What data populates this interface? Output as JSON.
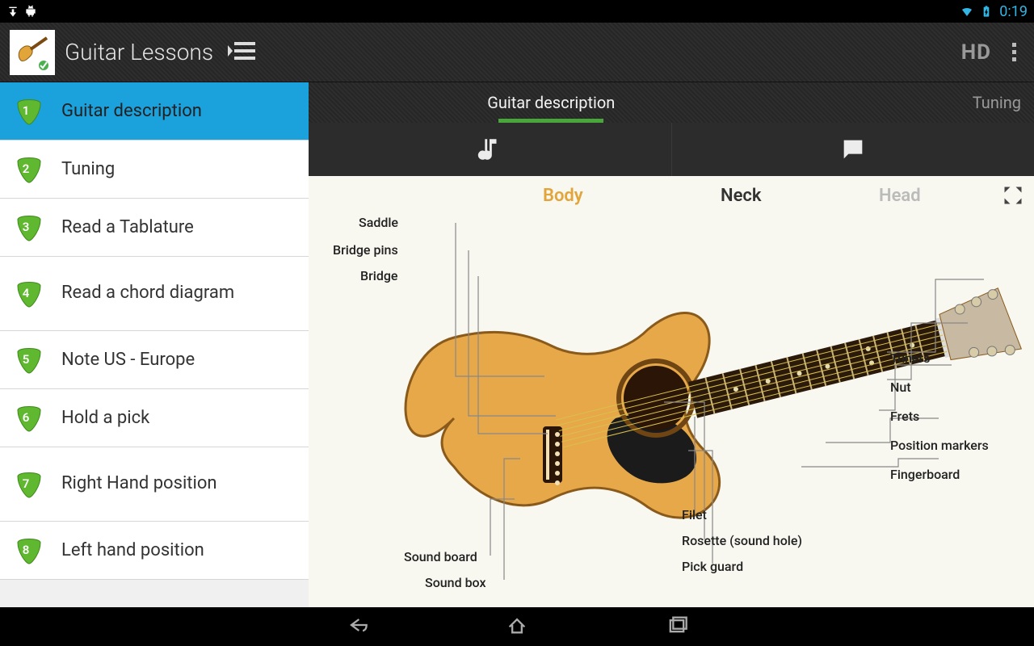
{
  "status": {
    "time": "0:19"
  },
  "actionbar": {
    "title": "Guitar Lessons",
    "hd_label": "HD"
  },
  "sidebar": {
    "items": [
      {
        "num": "1",
        "label": "Guitar description"
      },
      {
        "num": "2",
        "label": "Tuning"
      },
      {
        "num": "3",
        "label": "Read a Tablature"
      },
      {
        "num": "4",
        "label": "Read a chord diagram"
      },
      {
        "num": "5",
        "label": "Note US - Europe"
      },
      {
        "num": "6",
        "label": "Hold a pick"
      },
      {
        "num": "7",
        "label": "Right Hand position"
      },
      {
        "num": "8",
        "label": "Left hand position"
      }
    ]
  },
  "pager": {
    "tabs": [
      {
        "label": "Guitar description",
        "active": true
      },
      {
        "label": "Tuning",
        "active": false
      }
    ]
  },
  "diagram": {
    "sections": {
      "body": "Body",
      "neck": "Neck",
      "head": "Head"
    },
    "labels": {
      "saddle": "Saddle",
      "bridge_pins": "Bridge pins",
      "bridge": "Bridge",
      "sound_board": "Sound board",
      "sound_box": "Sound box",
      "filet": "Filet",
      "rosette": "Rosette (sound hole)",
      "pick_guard": "Pick guard",
      "tuners": "Tuners",
      "nut": "Nut",
      "frets": "Frets",
      "position_markers": "Position markers",
      "fingerboard": "Fingerboard"
    }
  }
}
